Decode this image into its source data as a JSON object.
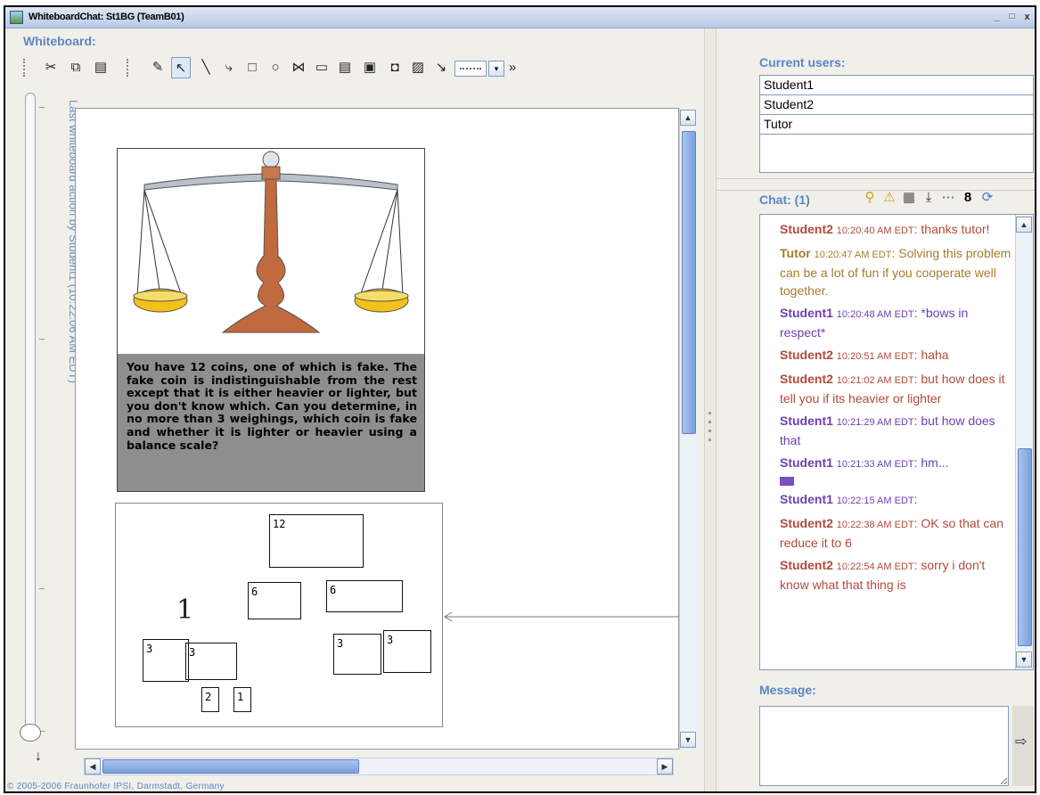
{
  "window": {
    "title": "WhiteboardChat: St1BG (TeamB01)",
    "min": "_",
    "max": "□",
    "close": "x"
  },
  "whiteboard": {
    "label": "Whiteboard:",
    "tools": {
      "cut": "✂",
      "copy": "⧉",
      "paste": "▤",
      "lasso": "✎",
      "select": "↖",
      "line": "╲",
      "connector": "⤷",
      "rect": "□",
      "ellipse": "○",
      "link": "⋈",
      "rounded": "▭",
      "note": "▤",
      "dark_note": "▣",
      "camera": "◘",
      "image": "▨",
      "pointer_tool": "↘",
      "overflow": "»",
      "dropdown": "▾"
    },
    "history_label": "Last whiteboard action by Student1 (10:22:06 AM EDT)",
    "download_icon": "↓",
    "problem_text": "You have 12 coins, one of which is fake. The fake coin is indistinguishable from the rest except that it is either heavier or lighter, but you don't know which. Can you determine, in no more than 3 weighings, which coin is fake and whether it is lighter or heavier using a balance scale?",
    "sketch": {
      "b12": "12",
      "b6a": "6",
      "b6b": "6",
      "b3a": "3",
      "b3b": "3",
      "b3c": "3",
      "b3d": "3",
      "b2": "2",
      "b1": "1",
      "scribble": "1"
    },
    "copyright": "© 2005-2006 Fraunhofer IPSI, Darmstadt, Germany"
  },
  "users": {
    "label": "Current users:",
    "list": [
      "Student1",
      "Student2",
      "Tutor"
    ]
  },
  "chat": {
    "label": "Chat: (1)",
    "messages": [
      {
        "name": "Student2",
        "time": "10:20:40 AM EDT",
        "sep": ":",
        "text": " thanks tutor!"
      },
      {
        "name": "Tutor",
        "time": "10:20:47 AM EDT",
        "sep": ":",
        "text": " Solving this problem can be a lot of fun if you cooperate well together."
      },
      {
        "name": "Student1",
        "time": "10:20:48 AM EDT",
        "sep": ":",
        "text": " *bows in respect*"
      },
      {
        "name": "Student2",
        "time": "10:20:51 AM EDT",
        "sep": ":",
        "text": " haha"
      },
      {
        "name": "Student2",
        "time": "10:21:02 AM EDT",
        "sep": ":",
        "text": " but how does it tell you if its heavier or lighter"
      },
      {
        "name": "Student1",
        "time": "10:21:29 AM EDT",
        "sep": ":",
        "text": " but how does that"
      },
      {
        "name": "Student1",
        "time": "10:21:33 AM EDT",
        "sep": ":",
        "text": " hm..."
      },
      {
        "name": "Student1",
        "time": "10:22:15 AM EDT",
        "sep": ":",
        "text": ""
      },
      {
        "name": "Student2",
        "time": "10:22:38 AM EDT",
        "sep": ":",
        "text": " OK so that can reduce it to 6"
      },
      {
        "name": "Student2",
        "time": "10:22:54 AM EDT",
        "sep": ":",
        "text": " sorry i don't know what that thing is"
      }
    ],
    "colors": {
      "Student1": "#6e3fb0",
      "Student2": "#b34a3a",
      "Tutor": "#a77b2e"
    }
  },
  "message": {
    "label": "Message:",
    "value": ""
  }
}
